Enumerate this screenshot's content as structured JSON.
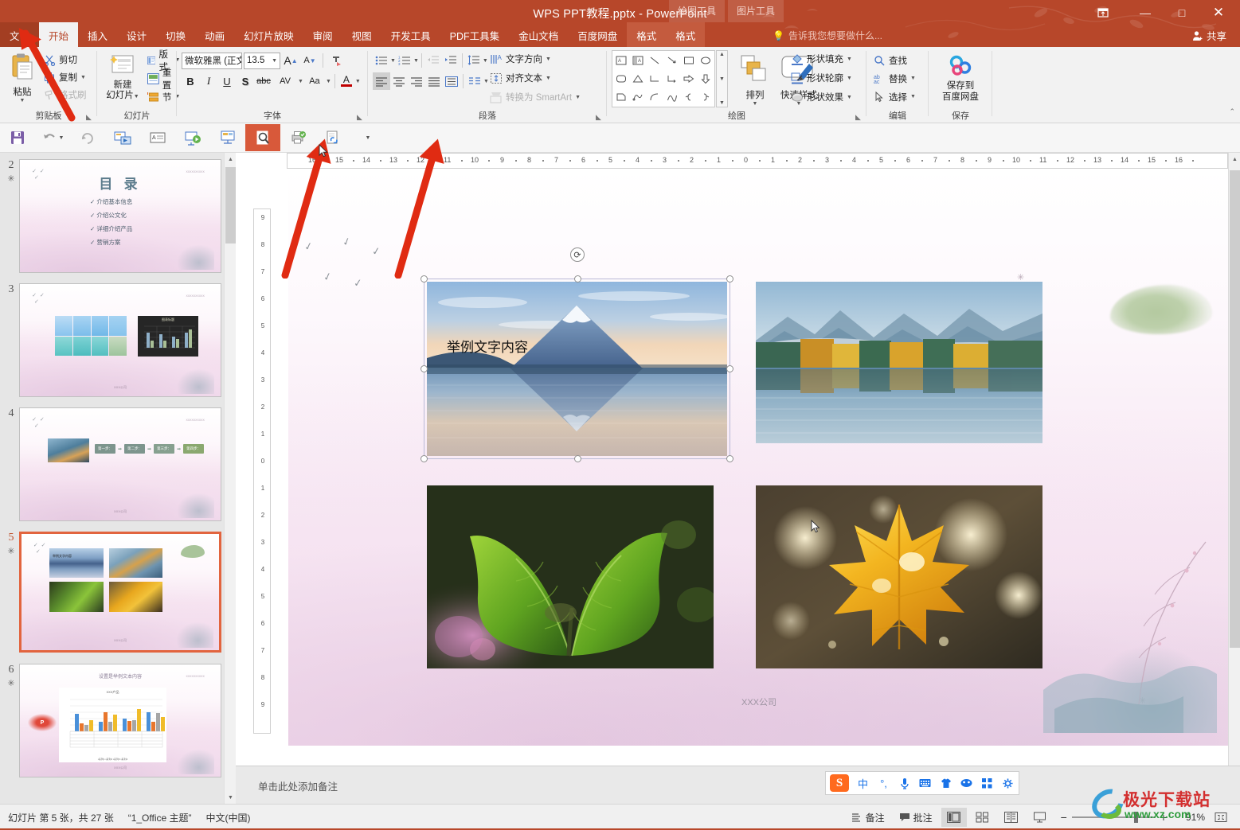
{
  "window": {
    "title": "WPS PPT教程.pptx - PowerPoint",
    "minimize": "—",
    "maximize": "□",
    "close": "✕",
    "ribbon_display_options": "ribbon-display-icon",
    "accent_color": "#b7472a"
  },
  "contextual_tabs": [
    {
      "head": "绘图工具",
      "tab": "格式"
    },
    {
      "head": "图片工具",
      "tab": "格式"
    }
  ],
  "tabs": [
    {
      "label": "文件",
      "active": false
    },
    {
      "label": "开始",
      "active": true
    },
    {
      "label": "插入",
      "active": false
    },
    {
      "label": "设计",
      "active": false
    },
    {
      "label": "切换",
      "active": false
    },
    {
      "label": "动画",
      "active": false
    },
    {
      "label": "幻灯片放映",
      "active": false
    },
    {
      "label": "审阅",
      "active": false
    },
    {
      "label": "视图",
      "active": false
    },
    {
      "label": "开发工具",
      "active": false
    },
    {
      "label": "PDF工具集",
      "active": false
    },
    {
      "label": "金山文档",
      "active": false
    },
    {
      "label": "百度网盘",
      "active": false
    }
  ],
  "tell_me": {
    "placeholder": "告诉我您想要做什么...",
    "icon": "lightbulb-icon"
  },
  "share": {
    "label": "共享",
    "icon": "share-person-icon"
  },
  "ribbon": {
    "clipboard": {
      "group_label": "剪贴板",
      "paste": "粘贴",
      "cut": "剪切",
      "copy": "复制",
      "format_painter": "格式刷"
    },
    "slides": {
      "group_label": "幻灯片",
      "new_slide": "新建\n幻灯片",
      "new_slide_line1": "新建",
      "new_slide_line2": "幻灯片",
      "layout": "版式",
      "reset": "重置",
      "section": "节"
    },
    "font": {
      "group_label": "字体",
      "font_name": "微软雅黑 (正文",
      "font_size": "13.5",
      "grow": "A",
      "shrink": "A",
      "clear_format": "clear-formatting-icon",
      "bold": "B",
      "italic": "I",
      "underline": "U",
      "shadow": "S",
      "strikethrough": "abc",
      "char_spacing": "AV",
      "change_case": "Aa",
      "font_color": "A"
    },
    "paragraph": {
      "group_label": "段落",
      "bullets": "bullets-icon",
      "numbering": "numbering-icon",
      "decrease_indent": "decrease-indent-icon",
      "increase_indent": "increase-indent-icon",
      "line_spacing": "line-spacing-icon",
      "text_direction": "文字方向",
      "align_text": "对齐文本",
      "convert_smartart": "转换为 SmartArt",
      "align_left": "align-left-icon",
      "align_center": "align-center-icon",
      "align_right": "align-right-icon",
      "justify": "justify-icon",
      "distribute": "distribute-icon",
      "columns": "columns-icon"
    },
    "drawing": {
      "group_label": "绘图",
      "arrange": "排列",
      "quick_styles": "快速样式",
      "shape_fill": "形状填充",
      "shape_outline": "形状轮廓",
      "shape_effects": "形状效果"
    },
    "editing": {
      "group_label": "编辑",
      "find": "查找",
      "replace": "替换",
      "select": "选择"
    },
    "save": {
      "group_label": "保存",
      "save_to_netdisk_line1": "保存到",
      "save_to_netdisk_line2": "百度网盘"
    }
  },
  "quick_access": [
    {
      "name": "save-icon",
      "highlighted": false
    },
    {
      "name": "undo-icon",
      "highlighted": false
    },
    {
      "name": "redo-icon",
      "highlighted": false
    },
    {
      "name": "start-from-current-icon",
      "highlighted": false
    },
    {
      "name": "text-box-icon",
      "highlighted": false
    },
    {
      "name": "start-slideshow-icon",
      "highlighted": false
    },
    {
      "name": "presenter-view-icon",
      "highlighted": false
    },
    {
      "name": "preview-icon",
      "highlighted": true
    },
    {
      "name": "quick-print-icon",
      "highlighted": false
    },
    {
      "name": "hyperlink-icon",
      "highlighted": false
    },
    {
      "name": "customize-qat-icon",
      "highlighted": false
    }
  ],
  "thumbnails": [
    {
      "number": "2",
      "star": "✳",
      "selected": false,
      "type": "contents",
      "title": "目 录",
      "items": [
        "介绍基本信息",
        "介绍公文化",
        "详细介绍产品",
        "营销方案"
      ],
      "footer": "XXX公司"
    },
    {
      "number": "3",
      "star": "",
      "selected": false,
      "type": "images-chart",
      "chart_title": "图表标题",
      "footer": "XXX公司"
    },
    {
      "number": "4",
      "star": "",
      "selected": false,
      "type": "process",
      "steps": [
        "第一步：",
        "第二步：",
        "第三步：",
        "第四步："
      ],
      "footer": "XXX公司"
    },
    {
      "number": "5",
      "star": "✳",
      "selected": true,
      "type": "four-images",
      "overlay_text": "举例文字内容",
      "footer": "XXX公司"
    },
    {
      "number": "6",
      "star": "✳",
      "selected": false,
      "type": "chart",
      "title": "设置是举例文本内容",
      "chart_title": "XXX产品",
      "footer": "XXX公司"
    }
  ],
  "ruler": {
    "horizontal": [
      "16",
      "15",
      "14",
      "13",
      "12",
      "11",
      "10",
      "9",
      "8",
      "7",
      "6",
      "5",
      "4",
      "3",
      "2",
      "1",
      "0",
      "1",
      "2",
      "3",
      "4",
      "5",
      "6",
      "7",
      "8",
      "9",
      "10",
      "11",
      "12",
      "13",
      "14",
      "15",
      "16"
    ],
    "vertical": [
      "9",
      "8",
      "7",
      "6",
      "5",
      "4",
      "3",
      "2",
      "1",
      "0",
      "1",
      "2",
      "3",
      "4",
      "5",
      "6",
      "7",
      "8",
      "9"
    ]
  },
  "slide": {
    "overlay_text": "举例文字内容",
    "footer": "XXX公司",
    "images": [
      {
        "name": "mount-fuji-lake-photo",
        "selected": true
      },
      {
        "name": "autumn-forest-lake-photo",
        "selected": false
      },
      {
        "name": "green-leaves-photo",
        "selected": false
      },
      {
        "name": "yellow-maple-leaf-photo",
        "selected": false
      }
    ],
    "rotate_handle": "rotate-handle-icon"
  },
  "notes": {
    "placeholder": "单击此处添加备注"
  },
  "ime": {
    "logo": "S",
    "mode": "中",
    "punctuation": "°,",
    "voice": "microphone-icon",
    "keyboard": "soft-keyboard-icon",
    "skin": "skin-icon",
    "emoji": "emoji-icon",
    "apps": "apps-icon",
    "settings": "settings-icon"
  },
  "status": {
    "slide_info": "幻灯片 第 5 张，共 27 张",
    "theme": "“1_Office 主题”",
    "language": "中文(中国)",
    "notes_button": "备注",
    "comments_button": "批注",
    "views": [
      {
        "name": "normal-view-button",
        "active": true
      },
      {
        "name": "slide-sorter-button",
        "active": false
      },
      {
        "name": "reading-view-button",
        "active": false
      },
      {
        "name": "slideshow-button",
        "active": false
      }
    ],
    "zoom_out": "−",
    "zoom_in": "+",
    "zoom_level": "91%",
    "fit_to_window": "fit-slide-icon"
  },
  "watermark": {
    "main": "极光下载站",
    "sub": "www.xz.com"
  }
}
